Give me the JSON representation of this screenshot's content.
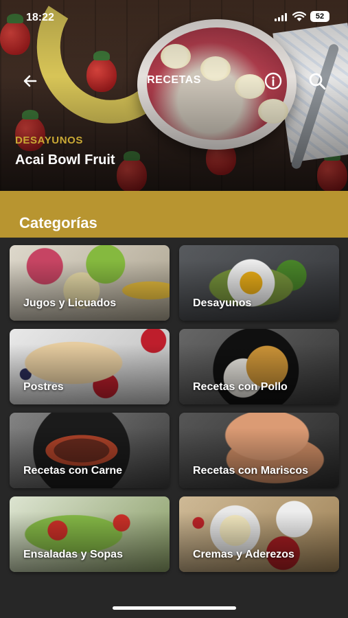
{
  "status_bar": {
    "time": "18:22",
    "battery": "52"
  },
  "header": {
    "title": "RECETAS",
    "back_icon": "arrow-left-icon",
    "info_icon": "info-icon",
    "search_icon": "search-icon"
  },
  "featured": {
    "category": "DESAYUNOS",
    "title": "Acai Bowl Fruit"
  },
  "section": {
    "title": "Categorías"
  },
  "categories": [
    {
      "label": "Jugos y Licuados"
    },
    {
      "label": "Desayunos"
    },
    {
      "label": "Postres"
    },
    {
      "label": "Recetas con Pollo"
    },
    {
      "label": "Recetas con Carne"
    },
    {
      "label": "Recetas con Mariscos"
    },
    {
      "label": "Ensaladas y Sopas"
    },
    {
      "label": "Cremas y Aderezos"
    }
  ],
  "colors": {
    "accent": "#b89530",
    "category_text": "#c9a935",
    "background": "#272727"
  }
}
